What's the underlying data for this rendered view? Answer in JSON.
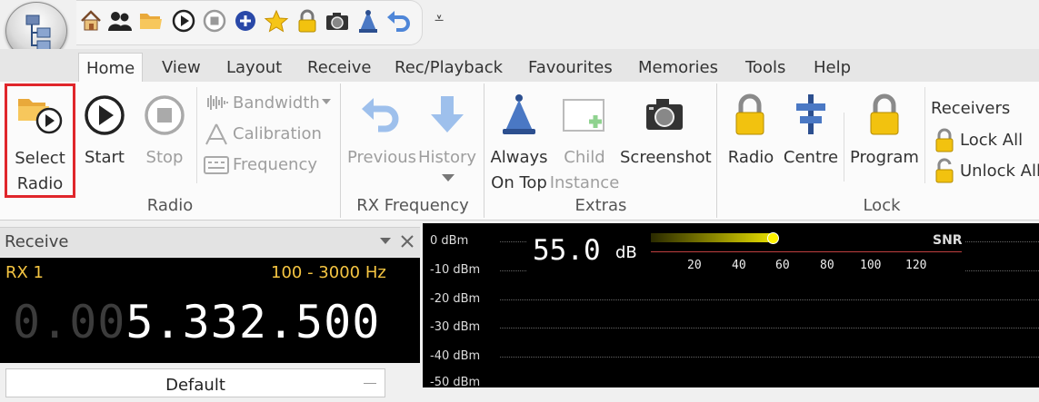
{
  "qat": {
    "icons": [
      "home-icon",
      "users-icon",
      "folder-icon",
      "play-icon",
      "stop-icon",
      "add-icon",
      "star-icon",
      "lock-icon",
      "camera-icon",
      "antenna-icon",
      "undo-icon"
    ],
    "more_glyph": "⩡"
  },
  "tabs": [
    "Home",
    "View",
    "Layout",
    "Receive",
    "Rec/Playback",
    "Favourites",
    "Memories",
    "Tools",
    "Help"
  ],
  "ribbon": {
    "radio": {
      "select_line1": "Select",
      "select_line2": "Radio",
      "start": "Start",
      "stop": "Stop",
      "bandwidth": "Bandwidth",
      "calibration": "Calibration",
      "frequency": "Frequency",
      "label": "Radio"
    },
    "rx_frequency": {
      "previous": "Previous",
      "history": "History",
      "label": "RX Frequency"
    },
    "extras": {
      "always_line1": "Always",
      "always_line2": "On Top",
      "child_line1": "Child",
      "child_line2": "Instance",
      "screenshot": "Screenshot",
      "label": "Extras"
    },
    "lock": {
      "radio": "Radio",
      "centre": "Centre",
      "program": "Program",
      "receivers": "Receivers",
      "lock_all": "Lock All",
      "unlock_all": "Unlock All",
      "label": "Lock"
    }
  },
  "receive_panel": {
    "title": "Receive",
    "rx_name": "RX 1",
    "bandwidth": "100 - 3000 Hz",
    "freq_dim": "0.00",
    "freq_bright": "5.332.500",
    "mode_select": "Default"
  },
  "spectrum": {
    "db_labels": [
      "0 dBm",
      "-10 dBm",
      "-20 dBm",
      "-30 dBm",
      "-40 dBm",
      "-50 dBm"
    ],
    "snr_value": "55.0",
    "snr_unit": "dB",
    "snr_label": "SNR",
    "snr_ticks": [
      "20",
      "40",
      "60",
      "80",
      "100",
      "120"
    ]
  },
  "colors": {
    "highlight_box": "#e0262b",
    "rx_text_yellow": "#f5c542",
    "snr_bar": "#e8e000"
  }
}
